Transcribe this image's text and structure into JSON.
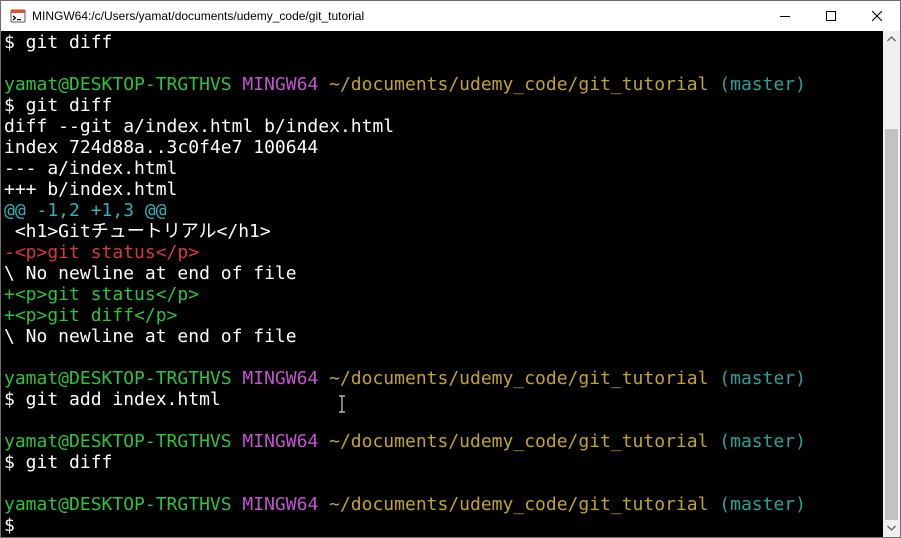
{
  "window": {
    "title": "MINGW64:/c/Users/yamat/documents/udemy_code/git_tutorial"
  },
  "terminal": {
    "lines": [
      [
        {
          "t": "$ git diff",
          "c": "default"
        }
      ],
      [],
      [
        {
          "t": "yamat@DESKTOP-TRGTHVS",
          "c": "user"
        },
        {
          "t": " ",
          "c": "default"
        },
        {
          "t": "MINGW64",
          "c": "host"
        },
        {
          "t": " ",
          "c": "default"
        },
        {
          "t": "~/documents/udemy_code/git_tutorial",
          "c": "path"
        },
        {
          "t": " ",
          "c": "default"
        },
        {
          "t": "(master)",
          "c": "branch"
        }
      ],
      [
        {
          "t": "$ git diff",
          "c": "default"
        }
      ],
      [
        {
          "t": "diff --git a/index.html b/index.html",
          "c": "default"
        }
      ],
      [
        {
          "t": "index 724d88a..3c0f4e7 100644",
          "c": "default"
        }
      ],
      [
        {
          "t": "--- a/index.html",
          "c": "default"
        }
      ],
      [
        {
          "t": "+++ b/index.html",
          "c": "default"
        }
      ],
      [
        {
          "t": "@@ -1,2 +1,3 @@",
          "c": "hunk"
        }
      ],
      [
        {
          "t": " <h1>Gitチュートリアル</h1>",
          "c": "default"
        }
      ],
      [
        {
          "t": "-<p>git status</p>",
          "c": "del"
        }
      ],
      [
        {
          "t": "\\ No newline at end of file",
          "c": "default"
        }
      ],
      [
        {
          "t": "+<p>git status</p>",
          "c": "add"
        }
      ],
      [
        {
          "t": "+<p>git diff</p>",
          "c": "add"
        }
      ],
      [
        {
          "t": "\\ No newline at end of file",
          "c": "default"
        }
      ],
      [],
      [
        {
          "t": "yamat@DESKTOP-TRGTHVS",
          "c": "user"
        },
        {
          "t": " ",
          "c": "default"
        },
        {
          "t": "MINGW64",
          "c": "host"
        },
        {
          "t": " ",
          "c": "default"
        },
        {
          "t": "~/documents/udemy_code/git_tutorial",
          "c": "path"
        },
        {
          "t": " ",
          "c": "default"
        },
        {
          "t": "(master)",
          "c": "branch"
        }
      ],
      [
        {
          "t": "$ git add index.html",
          "c": "default"
        }
      ],
      [],
      [
        {
          "t": "yamat@DESKTOP-TRGTHVS",
          "c": "user"
        },
        {
          "t": " ",
          "c": "default"
        },
        {
          "t": "MINGW64",
          "c": "host"
        },
        {
          "t": " ",
          "c": "default"
        },
        {
          "t": "~/documents/udemy_code/git_tutorial",
          "c": "path"
        },
        {
          "t": " ",
          "c": "default"
        },
        {
          "t": "(master)",
          "c": "branch"
        }
      ],
      [
        {
          "t": "$ git diff",
          "c": "default"
        }
      ],
      [],
      [
        {
          "t": "yamat@DESKTOP-TRGTHVS",
          "c": "user"
        },
        {
          "t": " ",
          "c": "default"
        },
        {
          "t": "MINGW64",
          "c": "host"
        },
        {
          "t": " ",
          "c": "default"
        },
        {
          "t": "~/documents/udemy_code/git_tutorial",
          "c": "path"
        },
        {
          "t": " ",
          "c": "default"
        },
        {
          "t": "(master)",
          "c": "branch"
        }
      ],
      [
        {
          "t": "$",
          "c": "default"
        }
      ]
    ]
  },
  "colors": {
    "terminal_bg": "#000000",
    "text": "#ffffff",
    "user": "#2fc23b",
    "host": "#c354cf",
    "path": "#c1a42e",
    "branch": "#2aa198",
    "hunk": "#2fb3b8",
    "deleted": "#d63a3a",
    "added": "#2fc23b"
  },
  "icons": {
    "app": "git-bash-icon",
    "minimize": "minimize-icon",
    "maximize": "maximize-icon",
    "close": "close-icon",
    "scroll_up": "scroll-up-arrow-icon",
    "scroll_down": "scroll-down-arrow-icon",
    "mouse_cursor": "text-cursor-icon"
  }
}
